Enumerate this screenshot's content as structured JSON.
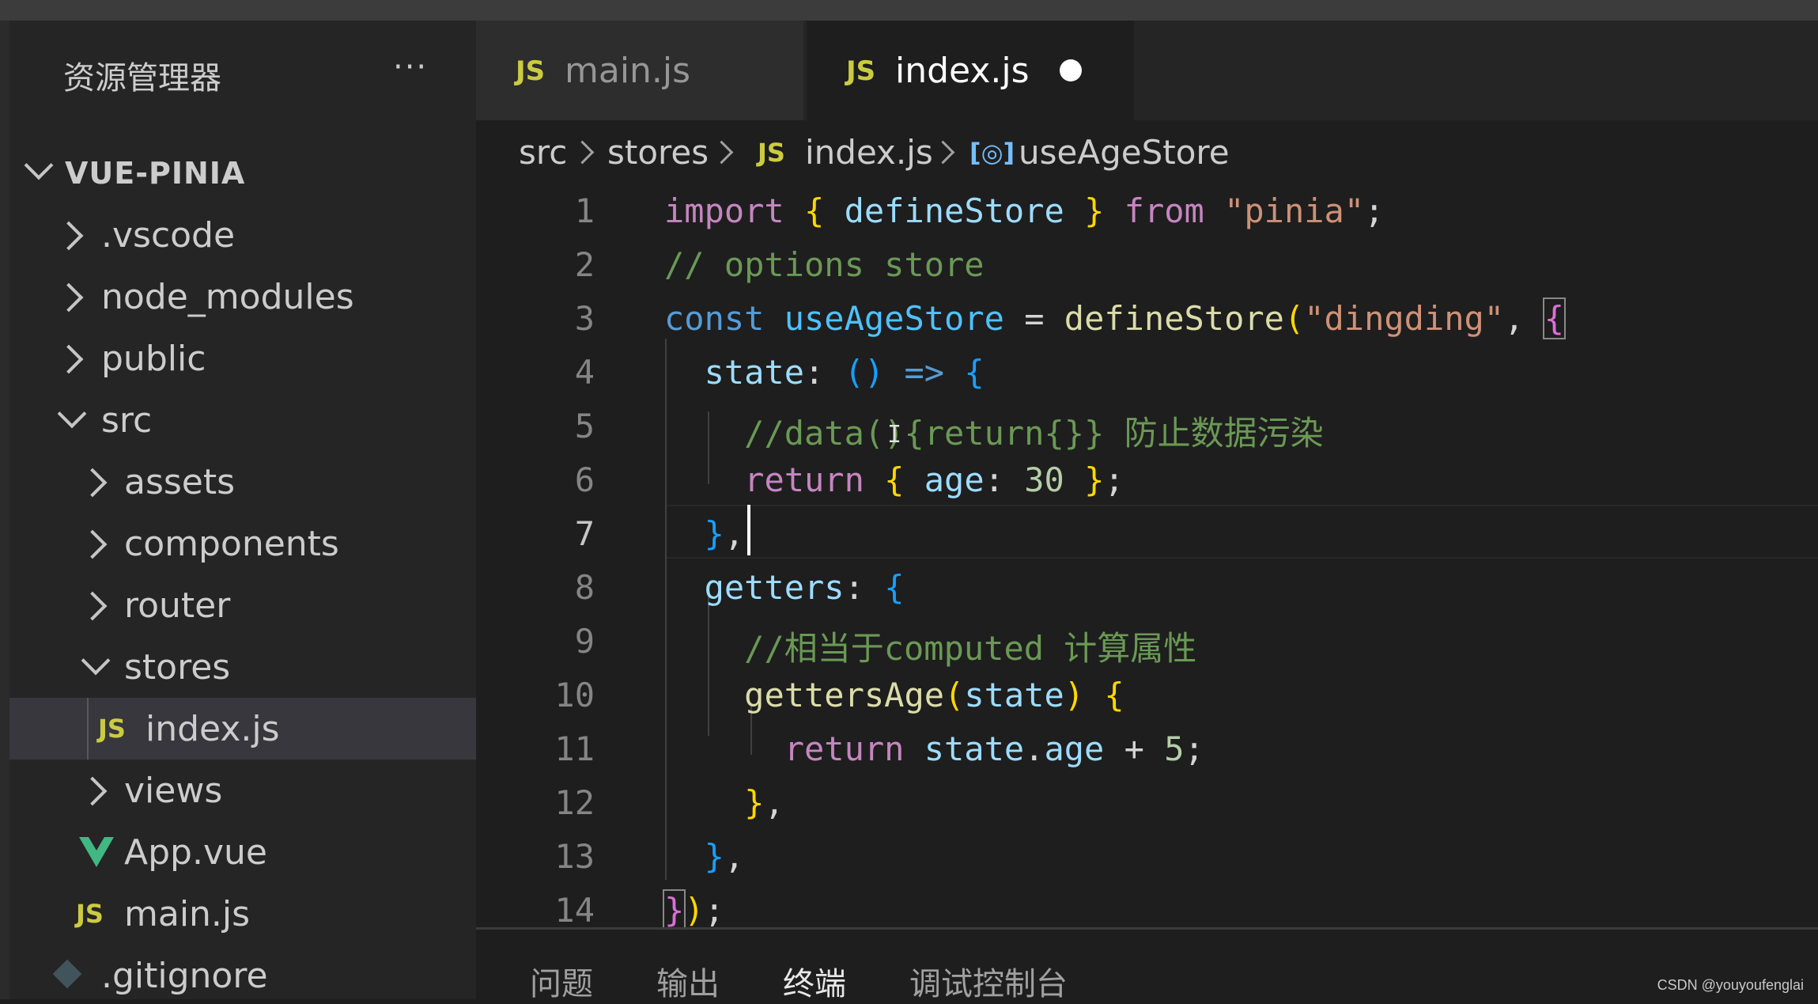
{
  "sidebar": {
    "title": "资源管理器",
    "more": "···",
    "root": "VUE-PINIA",
    "items": {
      "vscode": ".vscode",
      "node_modules": "node_modules",
      "public": "public",
      "src": "src",
      "assets": "assets",
      "components": "components",
      "router": "router",
      "stores": "stores",
      "indexjs": "index.js",
      "views": "views",
      "appvue": "App.vue",
      "mainjs": "main.js",
      "gitignore": ".gitignore"
    },
    "js_icon": "JS"
  },
  "tabs": [
    {
      "icon": "JS",
      "label": "main.js",
      "active": false
    },
    {
      "icon": "JS",
      "label": "index.js",
      "active": true,
      "modified": true
    }
  ],
  "breadcrumb": {
    "src": "src",
    "stores": "stores",
    "file_icon": "JS",
    "file": "index.js",
    "symbol": "useAgeStore"
  },
  "editor": {
    "line_numbers": [
      "1",
      "2",
      "3",
      "4",
      "5",
      "6",
      "7",
      "8",
      "9",
      "10",
      "11",
      "12",
      "13",
      "14"
    ],
    "current_line": 7,
    "tokens": {
      "l1": [
        "import",
        "{",
        "defineStore",
        "}",
        "from",
        "\"pinia\"",
        ";"
      ],
      "l2": "// options store",
      "l3": [
        "const",
        "useAgeStore",
        "=",
        "defineStore",
        "(",
        "\"dingding\"",
        ",",
        "{"
      ],
      "l4": [
        "state",
        ":",
        "()",
        "=>",
        "{"
      ],
      "l5": "//data(){return{}} 防止数据污染",
      "l6": [
        "return",
        "{",
        "age",
        ":",
        "30",
        "}",
        ";"
      ],
      "l7": [
        "}",
        ","
      ],
      "l8": [
        "getters",
        ":",
        "{"
      ],
      "l9": "//相当于computed 计算属性",
      "l10": [
        "gettersAge",
        "(",
        "state",
        ")",
        "{"
      ],
      "l11": [
        "return",
        "state",
        ".",
        "age",
        "+",
        "5",
        ";"
      ],
      "l12": [
        "}",
        ","
      ],
      "l13": [
        "}",
        ","
      ],
      "l14": [
        "}",
        ")",
        ";"
      ]
    }
  },
  "panel": {
    "tabs": [
      "问题",
      "输出",
      "终端",
      "调试控制台"
    ],
    "active": "终端"
  },
  "watermark": "CSDN @youyoufenglai"
}
